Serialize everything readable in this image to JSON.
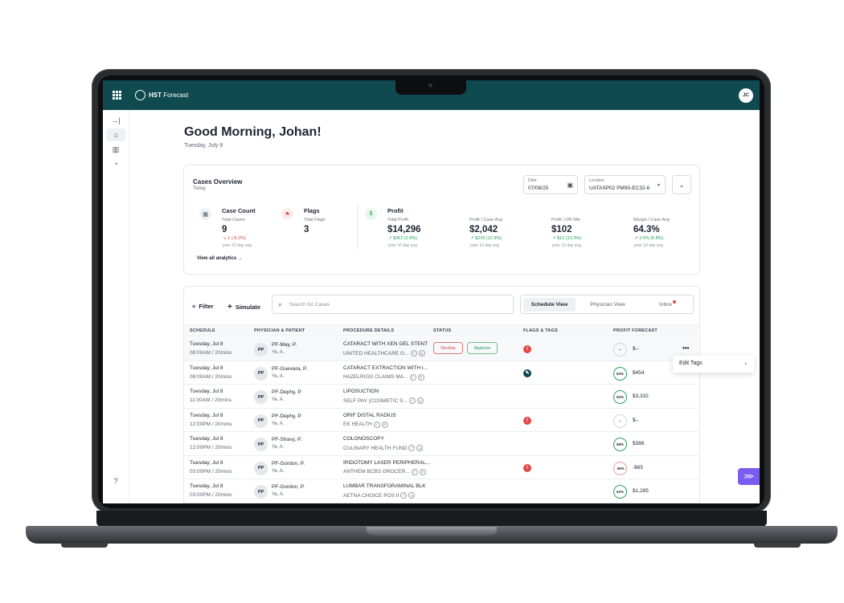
{
  "topbar": {
    "brand_bold": "HST",
    "brand_rest": " Forecast",
    "user_initials": "JC"
  },
  "greeting": {
    "title": "Good Morning, Johan!",
    "date": "Tuesday, July 8"
  },
  "overview": {
    "title": "Cases Overview",
    "subtitle": "Today",
    "date_label": "Date",
    "date_value": "07/08/25",
    "location_label": "Location",
    "location_value": "UATASP02 PM90-EC32-6",
    "metrics": {
      "case_count": {
        "title": "Case Count",
        "label": "Total Cases",
        "value": "9",
        "delta": "↘ 1 (-8.2%)",
        "note": "prior 10 day avg"
      },
      "flags": {
        "title": "Flags",
        "label": "Total Flags",
        "value": "3"
      },
      "profit": {
        "title": "Profit"
      },
      "total_profit": {
        "label": "Total Profit",
        "value": "$14,296",
        "delta": "↗ $362 (2.6%)",
        "note": "prior 10 day avg"
      },
      "profit_case": {
        "label": "Profit / Case Avg",
        "value": "$2,042",
        "delta": "↗ $233 (12.9%)",
        "note": "prior 10 day avg"
      },
      "profit_or": {
        "label": "Profit / OR Min",
        "value": "$102",
        "delta": "↗ $12 (13.3%)",
        "note": "prior 10 day avg"
      },
      "margin": {
        "label": "Margin / Case Avg",
        "value": "64.3%",
        "delta": "↗ 3.5% (5.8%)",
        "note": "prior 10 day avg"
      }
    },
    "analytics_link": "View all analytics →"
  },
  "cases": {
    "filter_label": "Filter",
    "simulate_label": "Simulate",
    "search_placeholder": "Search for Cases",
    "views": [
      "Schedule View",
      "Physician View",
      "Inbox"
    ],
    "headers": [
      "SCHEDULE",
      "PHYSICIAN & PATIENT",
      "PROCEDURE DETAILS",
      "STATUS",
      "FLAGS & TAGS",
      "PROFIT FORECAST"
    ],
    "decline_label": "Decline",
    "approve_label": "Approve",
    "rows": [
      {
        "day": "Tuesday, Jul 8",
        "time": "08:00AM / 20mins",
        "initials": "PP",
        "physician": "PF-May, P.",
        "patient": "Ye, A.",
        "procedure": "CATARACT WITH XEN GEL STENT",
        "payer": "UNITED HEALTHCARE G...",
        "ring": "--",
        "profit": "$--"
      },
      {
        "day": "Tuesday, Jul 8",
        "time": "08:00AM / 20mins",
        "initials": "PP",
        "physician": "PF-Guevara, P.",
        "patient": "Ye, A.",
        "procedure": "CATARACT EXTRACTION WITH I...",
        "payer": "HAZELRIGG CLAIMS MA...",
        "ring": "62%",
        "profit": "$454"
      },
      {
        "day": "Tuesday, Jul 8",
        "time": "11:00AM / 20mins",
        "initials": "PP",
        "physician": "PF-Dephy, P.",
        "patient": "Ye, A.",
        "procedure": "LIPOSUCTION",
        "payer": "SELF PAY (COSMETIC S...",
        "ring": "52%",
        "profit": "$3,332"
      },
      {
        "day": "Tuesday, Jul 8",
        "time": "12:00PM / 20mins",
        "initials": "PP",
        "physician": "PF-Dephy, P.",
        "patient": "Ye, A.",
        "procedure": "ORIF DISTAL RADIUS",
        "payer": "EK HEALTH",
        "ring": "--",
        "profit": "$--"
      },
      {
        "day": "Tuesday, Jul 8",
        "time": "12:00PM / 20mins",
        "initials": "PP",
        "physician": "PF-Stravy, P.",
        "patient": "Ye, A.",
        "procedure": "COLONOSCOPY",
        "payer": "CULINARY HEALTH FUND",
        "ring": "58%",
        "profit": "$388"
      },
      {
        "day": "Tuesday, Jul 8",
        "time": "03:00PM / 20mins",
        "initials": "PP",
        "physician": "PF-Gordon, P.",
        "patient": "Ye, A.",
        "procedure": "IRIDOTOMY LASER PERIPHERAL...",
        "payer": "ANTHEM BCBS GROCER...",
        "ring": "-39%",
        "profit": "-$65"
      },
      {
        "day": "Tuesday, Jul 8",
        "time": "03:00PM / 20mins",
        "initials": "PP",
        "physician": "PF-Gordon, P.",
        "patient": "Ye, A.",
        "procedure": "LUMBAR TRANSFORAMINAL BLK",
        "payer": "AETNA CHOICE POS II",
        "ring": "62%",
        "profit": "$1,285"
      }
    ]
  },
  "context_menu": {
    "item": "Edit Tags"
  },
  "colors": {
    "brand": "#0e4a4f",
    "accent": "#7b5cf0",
    "positive": "#1f9d55",
    "negative": "#d64545"
  }
}
